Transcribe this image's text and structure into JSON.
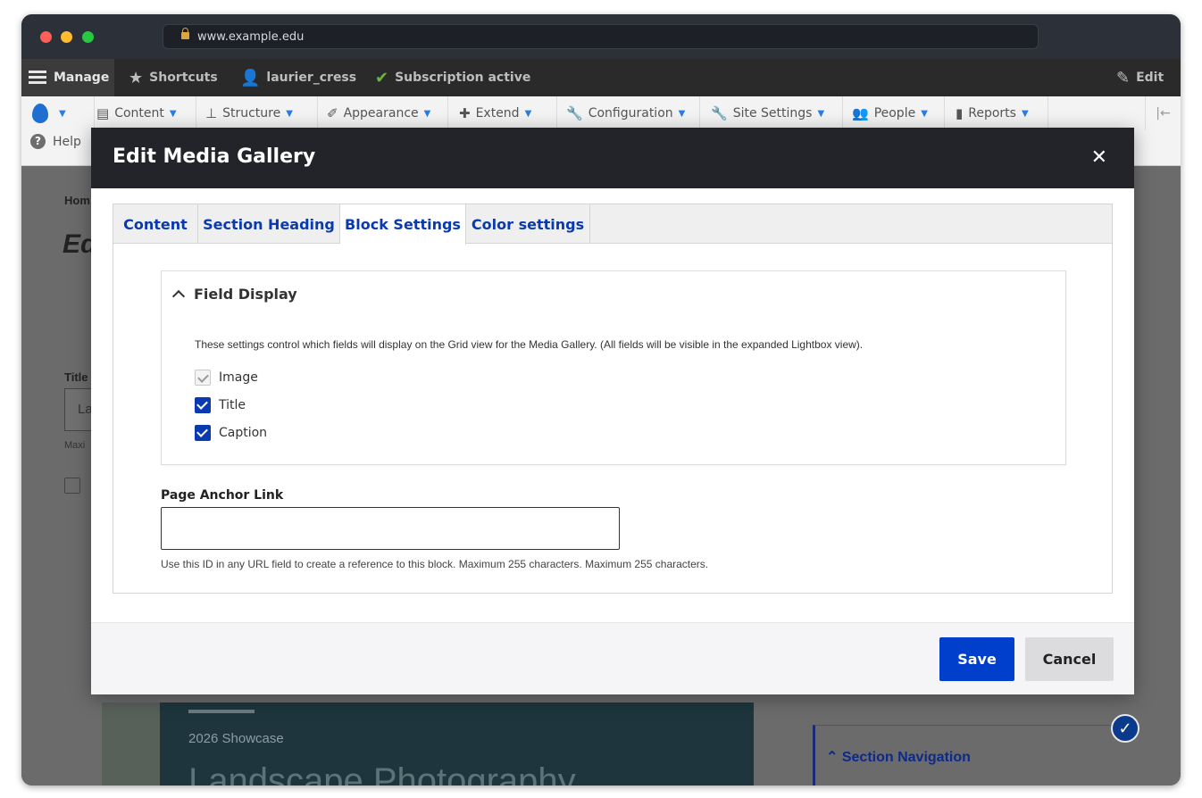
{
  "browser": {
    "url": "www.example.edu"
  },
  "toolbar": {
    "manage": "Manage",
    "shortcuts": "Shortcuts",
    "user": "laurier_cress",
    "subscription": "Subscription active",
    "edit": "Edit"
  },
  "admin_menu": {
    "items": [
      "Content",
      "Structure",
      "Appearance",
      "Extend",
      "Configuration",
      "Site Settings",
      "People",
      "Reports"
    ],
    "help": "Help"
  },
  "background": {
    "breadcrumb": "Hom",
    "title": "Ed",
    "field_label": "Title",
    "field_value": "La",
    "field_hint": "Maxi",
    "card_subtitle": "2026 Showcase",
    "card_title": "Landscape Photography",
    "sidebar_item": "Section Navigation"
  },
  "modal": {
    "title": "Edit Media Gallery",
    "tabs": [
      "Content",
      "Section Heading",
      "Block Settings",
      "Color settings"
    ],
    "active_tab": "Block Settings",
    "fieldset": {
      "legend": "Field Display",
      "description": "These settings control which fields will display on the Grid view for the Media Gallery. (All fields will be visible in the expanded Lightbox view).",
      "options": [
        {
          "label": "Image",
          "checked": true,
          "disabled": true
        },
        {
          "label": "Title",
          "checked": true,
          "disabled": false
        },
        {
          "label": "Caption",
          "checked": true,
          "disabled": false
        }
      ]
    },
    "anchor": {
      "label": "Page Anchor Link",
      "value": "",
      "hint": "Use this ID in any URL field to create a reference to this block. Maximum 255 characters. Maximum 255 characters."
    },
    "buttons": {
      "save": "Save",
      "cancel": "Cancel"
    }
  },
  "colors": {
    "accent": "#003ecc",
    "tab_text": "#0a3aaf",
    "modal_header": "#232429"
  }
}
